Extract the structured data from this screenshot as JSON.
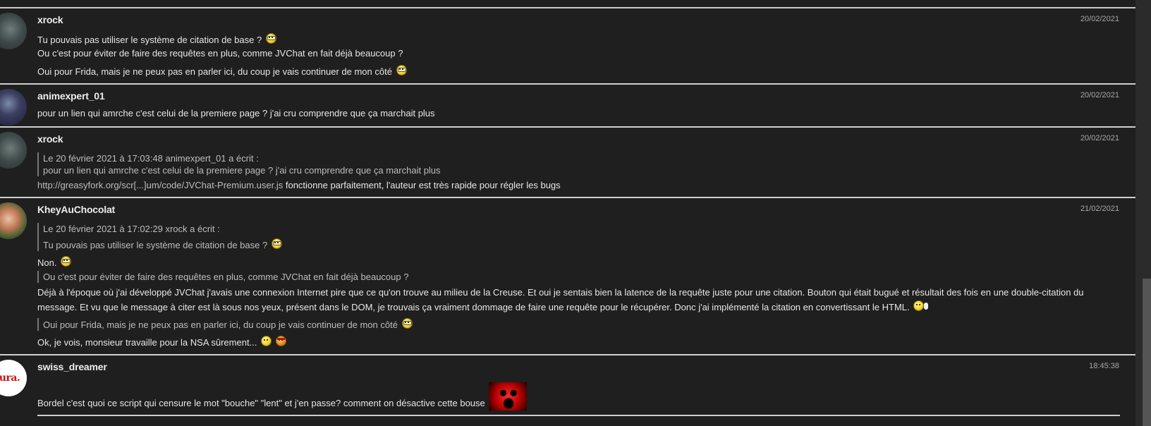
{
  "posts": [
    {
      "author": "xrock",
      "date": "20/02/2021",
      "lines": [
        "Tu pouvais pas utiliser le système de citation de base ?",
        "Ou c'est pour éviter de faire des requêtes en plus, comme JVChat en fait déjà beaucoup ?",
        "Oui pour Frida, mais je ne peux pas en parler ici, du coup je vais continuer de mon côté"
      ]
    },
    {
      "author": "animexpert_01",
      "date": "20/02/2021",
      "lines": [
        "pour un lien qui amrche c'est celui de la premiere page ? j'ai cru comprendre que ça marchait plus"
      ]
    },
    {
      "author": "xrock",
      "date": "20/02/2021",
      "quote": {
        "header": "Le 20 février 2021 à 17:03:48 animexpert_01 a écrit :",
        "text": "pour un lien qui amrche c'est celui de la premiere page ? j'ai cru comprendre que ça marchait plus"
      },
      "link": "http://greasyfork.org/scr[...]um/code/JVChat-Premium.user.js",
      "after_link": " fonctionne parfaitement, l'auteur est très rapide pour régler les bugs"
    },
    {
      "author": "KheyAuChocolat",
      "date": "21/02/2021",
      "quote1": {
        "header": "Le 20 février 2021 à 17:02:29 xrock a écrit :",
        "text": "Tu pouvais pas utiliser le système de citation de base ?"
      },
      "reply1": "Non.",
      "quote2": "Ou c'est pour éviter de faire des requêtes en plus, comme JVChat en fait déjà beaucoup ?",
      "reply2a": "Déjà à l'époque où j'ai développé JVChat j'avais une connexion Internet pire que ce qu'on trouve au milieu de la Creuse. Et oui je sentais bien la latence de la requête juste pour une citation. Bouton qui était bugué et résultait des fois en une double-citation du",
      "reply2b": "message. Et vu que le message à citer est là sous nos yeux, présent dans le DOM, je trouvais ça vraiment dommage de faire une requête pour le récupérer. Donc j'ai implémenté la citation en convertissant le HTML.",
      "quote3": "Oui pour Frida, mais je ne peux pas en parler ici, du coup je vais continuer de mon côté",
      "reply3": "Ok, je vois, monsieur travaille pour la NSA sûrement..."
    },
    {
      "author": "swiss_dreamer",
      "date": "18:45:38",
      "avatar_text": "ssura.",
      "lines": [
        "Bordel c'est quoi ce script qui censure le mot \"bouche\" \"lent\" et j'en passe? comment on désactive cette bouse"
      ]
    }
  ],
  "icons": [
    "smiley-icon",
    "glasses-smiley-icon",
    "angry-smiley-icon",
    "speech-bubble-icon"
  ],
  "colors": {
    "background": "#1f1f1f",
    "separator": "#cfcfcf",
    "text": "#e6e6e6",
    "quote_text": "#bdbdbd"
  }
}
